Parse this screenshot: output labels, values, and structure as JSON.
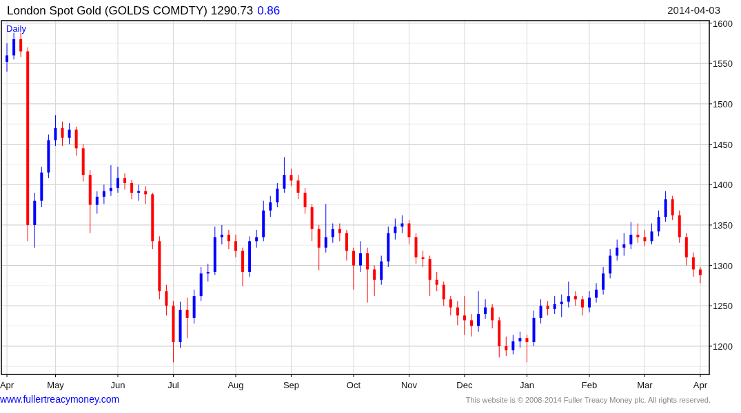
{
  "header": {
    "title": "London Spot Gold (GOLDS COMDTY) 1290.73",
    "change": "0.86",
    "date": "2014-04-03"
  },
  "chart": {
    "interval": "Daily",
    "chart_data": {
      "type": "candlestick",
      "grid": true,
      "ylim": [
        1165,
        1603
      ],
      "yticks": [
        1200,
        1250,
        1300,
        1350,
        1400,
        1450,
        1500,
        1550,
        1600
      ],
      "categories": [
        "Apr",
        null,
        null,
        null,
        null,
        null,
        null,
        "May",
        null,
        null,
        null,
        null,
        null,
        null,
        null,
        null,
        "Jun",
        null,
        null,
        null,
        null,
        null,
        null,
        null,
        "Jul",
        null,
        null,
        null,
        null,
        null,
        null,
        null,
        null,
        "Aug",
        null,
        null,
        null,
        null,
        null,
        null,
        null,
        "Sep",
        null,
        null,
        null,
        null,
        null,
        null,
        null,
        null,
        "Oct",
        null,
        null,
        null,
        null,
        null,
        null,
        null,
        "Nov",
        null,
        null,
        null,
        null,
        null,
        null,
        null,
        "Dec",
        null,
        null,
        null,
        null,
        null,
        null,
        null,
        null,
        "Jan",
        null,
        null,
        null,
        null,
        null,
        null,
        null,
        null,
        "Feb",
        null,
        null,
        null,
        null,
        null,
        null,
        null,
        "Mar",
        null,
        null,
        null,
        null,
        null,
        null,
        null,
        "Apr"
      ],
      "ohlc": [
        [
          1552,
          1575,
          1540,
          1560
        ],
        [
          1560,
          1588,
          1555,
          1580
        ],
        [
          1580,
          1588,
          1558,
          1565
        ],
        [
          1565,
          1570,
          1330,
          1350
        ],
        [
          1350,
          1390,
          1322,
          1380
        ],
        [
          1380,
          1422,
          1372,
          1415
        ],
        [
          1415,
          1462,
          1408,
          1455
        ],
        [
          1455,
          1486,
          1448,
          1470
        ],
        [
          1470,
          1478,
          1448,
          1458
        ],
        [
          1458,
          1476,
          1450,
          1468
        ],
        [
          1468,
          1472,
          1436,
          1445
        ],
        [
          1445,
          1450,
          1404,
          1412
        ],
        [
          1412,
          1418,
          1340,
          1375
        ],
        [
          1375,
          1392,
          1364,
          1385
        ],
        [
          1385,
          1400,
          1376,
          1392
        ],
        [
          1392,
          1424,
          1386,
          1396
        ],
        [
          1396,
          1422,
          1390,
          1408
        ],
        [
          1408,
          1414,
          1394,
          1402
        ],
        [
          1402,
          1406,
          1382,
          1390
        ],
        [
          1390,
          1400,
          1380,
          1392
        ],
        [
          1392,
          1398,
          1376,
          1388
        ],
        [
          1388,
          1390,
          1320,
          1330
        ],
        [
          1330,
          1336,
          1258,
          1268
        ],
        [
          1268,
          1276,
          1238,
          1250
        ],
        [
          1250,
          1256,
          1180,
          1205
        ],
        [
          1205,
          1255,
          1198,
          1245
        ],
        [
          1245,
          1260,
          1210,
          1235
        ],
        [
          1235,
          1270,
          1228,
          1262
        ],
        [
          1262,
          1298,
          1256,
          1290
        ],
        [
          1290,
          1302,
          1280,
          1292
        ],
        [
          1292,
          1348,
          1288,
          1335
        ],
        [
          1335,
          1350,
          1326,
          1338
        ],
        [
          1338,
          1344,
          1320,
          1330
        ],
        [
          1330,
          1338,
          1310,
          1318
        ],
        [
          1318,
          1322,
          1274,
          1292
        ],
        [
          1292,
          1336,
          1286,
          1330
        ],
        [
          1330,
          1344,
          1322,
          1335
        ],
        [
          1335,
          1380,
          1330,
          1368
        ],
        [
          1368,
          1386,
          1360,
          1378
        ],
        [
          1378,
          1402,
          1372,
          1395
        ],
        [
          1395,
          1434,
          1390,
          1412
        ],
        [
          1412,
          1420,
          1398,
          1405
        ],
        [
          1405,
          1412,
          1382,
          1390
        ],
        [
          1390,
          1396,
          1364,
          1372
        ],
        [
          1372,
          1376,
          1330,
          1345
        ],
        [
          1345,
          1350,
          1294,
          1322
        ],
        [
          1322,
          1376,
          1316,
          1335
        ],
        [
          1335,
          1352,
          1328,
          1345
        ],
        [
          1345,
          1352,
          1330,
          1340
        ],
        [
          1340,
          1344,
          1306,
          1318
        ],
        [
          1318,
          1322,
          1270,
          1300
        ],
        [
          1300,
          1330,
          1292,
          1315
        ],
        [
          1315,
          1322,
          1254,
          1295
        ],
        [
          1295,
          1300,
          1262,
          1282
        ],
        [
          1282,
          1312,
          1276,
          1305
        ],
        [
          1305,
          1348,
          1298,
          1340
        ],
        [
          1340,
          1358,
          1332,
          1348
        ],
        [
          1348,
          1362,
          1340,
          1352
        ],
        [
          1352,
          1356,
          1326,
          1335
        ],
        [
          1335,
          1340,
          1302,
          1310
        ],
        [
          1310,
          1318,
          1298,
          1308
        ],
        [
          1308,
          1312,
          1262,
          1282
        ],
        [
          1282,
          1292,
          1268,
          1276
        ],
        [
          1276,
          1280,
          1250,
          1258
        ],
        [
          1258,
          1262,
          1238,
          1248
        ],
        [
          1248,
          1256,
          1226,
          1238
        ],
        [
          1238,
          1262,
          1214,
          1232
        ],
        [
          1232,
          1240,
          1212,
          1225
        ],
        [
          1225,
          1268,
          1218,
          1240
        ],
        [
          1240,
          1258,
          1234,
          1248
        ],
        [
          1248,
          1252,
          1222,
          1232
        ],
        [
          1232,
          1236,
          1186,
          1200
        ],
        [
          1200,
          1212,
          1188,
          1195
        ],
        [
          1195,
          1214,
          1190,
          1206
        ],
        [
          1206,
          1218,
          1198,
          1210
        ],
        [
          1210,
          1214,
          1180,
          1205
        ],
        [
          1205,
          1244,
          1200,
          1235
        ],
        [
          1235,
          1258,
          1228,
          1250
        ],
        [
          1250,
          1256,
          1238,
          1246
        ],
        [
          1246,
          1262,
          1240,
          1252
        ],
        [
          1252,
          1264,
          1236,
          1255
        ],
        [
          1255,
          1280,
          1248,
          1262
        ],
        [
          1262,
          1268,
          1250,
          1258
        ],
        [
          1258,
          1262,
          1238,
          1248
        ],
        [
          1248,
          1268,
          1242,
          1260
        ],
        [
          1260,
          1278,
          1254,
          1270
        ],
        [
          1270,
          1298,
          1264,
          1290
        ],
        [
          1290,
          1320,
          1284,
          1312
        ],
        [
          1312,
          1332,
          1306,
          1322
        ],
        [
          1322,
          1340,
          1312,
          1326
        ],
        [
          1326,
          1354,
          1320,
          1338
        ],
        [
          1338,
          1352,
          1328,
          1335
        ],
        [
          1335,
          1344,
          1324,
          1330
        ],
        [
          1330,
          1352,
          1326,
          1342
        ],
        [
          1342,
          1368,
          1336,
          1360
        ],
        [
          1360,
          1392,
          1354,
          1382
        ],
        [
          1382,
          1386,
          1356,
          1362
        ],
        [
          1362,
          1368,
          1328,
          1335
        ],
        [
          1335,
          1340,
          1300,
          1310
        ],
        [
          1310,
          1316,
          1286,
          1295
        ],
        [
          1295,
          1298,
          1278,
          1288
        ]
      ]
    }
  },
  "footer": {
    "link": "www.fullertreacymoney.com",
    "copyright": "This website is © 2008-2014 Fuller Treacy Money plc. All rights reserved."
  }
}
